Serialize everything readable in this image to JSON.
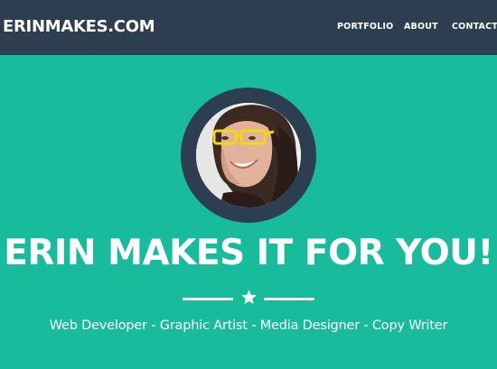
{
  "navbar": {
    "brand": "ERINMAKES.COM",
    "links": [
      {
        "label": "PORTFOLIO"
      },
      {
        "label": "ABOUT"
      },
      {
        "label": "CONTACT"
      }
    ]
  },
  "hero": {
    "avatar_icon": "profile-photo",
    "headline": "ERIN MAKES IT FOR YOU!",
    "divider_icon": "star-icon",
    "tagline": "Web Developer - Graphic Artist - Media Designer - Copy Writer"
  },
  "colors": {
    "navbar_bg": "#2c3e50",
    "hero_bg": "#18bc9c",
    "text": "#ffffff",
    "glasses": "#f5d90a"
  }
}
